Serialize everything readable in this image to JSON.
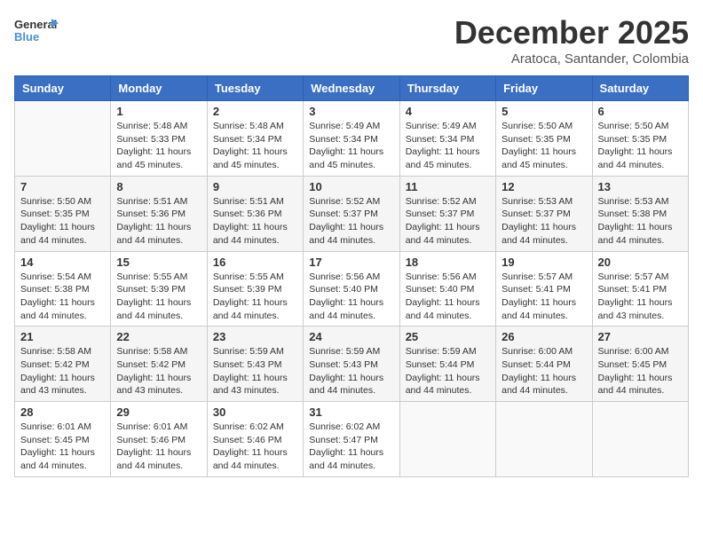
{
  "logo": {
    "text_general": "General",
    "text_blue": "Blue"
  },
  "title": "December 2025",
  "location": "Aratoca, Santander, Colombia",
  "weekdays": [
    "Sunday",
    "Monday",
    "Tuesday",
    "Wednesday",
    "Thursday",
    "Friday",
    "Saturday"
  ],
  "weeks": [
    [
      {
        "day": "",
        "info": ""
      },
      {
        "day": "1",
        "info": "Sunrise: 5:48 AM\nSunset: 5:33 PM\nDaylight: 11 hours\nand 45 minutes."
      },
      {
        "day": "2",
        "info": "Sunrise: 5:48 AM\nSunset: 5:34 PM\nDaylight: 11 hours\nand 45 minutes."
      },
      {
        "day": "3",
        "info": "Sunrise: 5:49 AM\nSunset: 5:34 PM\nDaylight: 11 hours\nand 45 minutes."
      },
      {
        "day": "4",
        "info": "Sunrise: 5:49 AM\nSunset: 5:34 PM\nDaylight: 11 hours\nand 45 minutes."
      },
      {
        "day": "5",
        "info": "Sunrise: 5:50 AM\nSunset: 5:35 PM\nDaylight: 11 hours\nand 45 minutes."
      },
      {
        "day": "6",
        "info": "Sunrise: 5:50 AM\nSunset: 5:35 PM\nDaylight: 11 hours\nand 44 minutes."
      }
    ],
    [
      {
        "day": "7",
        "info": "Sunrise: 5:50 AM\nSunset: 5:35 PM\nDaylight: 11 hours\nand 44 minutes."
      },
      {
        "day": "8",
        "info": "Sunrise: 5:51 AM\nSunset: 5:36 PM\nDaylight: 11 hours\nand 44 minutes."
      },
      {
        "day": "9",
        "info": "Sunrise: 5:51 AM\nSunset: 5:36 PM\nDaylight: 11 hours\nand 44 minutes."
      },
      {
        "day": "10",
        "info": "Sunrise: 5:52 AM\nSunset: 5:37 PM\nDaylight: 11 hours\nand 44 minutes."
      },
      {
        "day": "11",
        "info": "Sunrise: 5:52 AM\nSunset: 5:37 PM\nDaylight: 11 hours\nand 44 minutes."
      },
      {
        "day": "12",
        "info": "Sunrise: 5:53 AM\nSunset: 5:37 PM\nDaylight: 11 hours\nand 44 minutes."
      },
      {
        "day": "13",
        "info": "Sunrise: 5:53 AM\nSunset: 5:38 PM\nDaylight: 11 hours\nand 44 minutes."
      }
    ],
    [
      {
        "day": "14",
        "info": "Sunrise: 5:54 AM\nSunset: 5:38 PM\nDaylight: 11 hours\nand 44 minutes."
      },
      {
        "day": "15",
        "info": "Sunrise: 5:55 AM\nSunset: 5:39 PM\nDaylight: 11 hours\nand 44 minutes."
      },
      {
        "day": "16",
        "info": "Sunrise: 5:55 AM\nSunset: 5:39 PM\nDaylight: 11 hours\nand 44 minutes."
      },
      {
        "day": "17",
        "info": "Sunrise: 5:56 AM\nSunset: 5:40 PM\nDaylight: 11 hours\nand 44 minutes."
      },
      {
        "day": "18",
        "info": "Sunrise: 5:56 AM\nSunset: 5:40 PM\nDaylight: 11 hours\nand 44 minutes."
      },
      {
        "day": "19",
        "info": "Sunrise: 5:57 AM\nSunset: 5:41 PM\nDaylight: 11 hours\nand 44 minutes."
      },
      {
        "day": "20",
        "info": "Sunrise: 5:57 AM\nSunset: 5:41 PM\nDaylight: 11 hours\nand 43 minutes."
      }
    ],
    [
      {
        "day": "21",
        "info": "Sunrise: 5:58 AM\nSunset: 5:42 PM\nDaylight: 11 hours\nand 43 minutes."
      },
      {
        "day": "22",
        "info": "Sunrise: 5:58 AM\nSunset: 5:42 PM\nDaylight: 11 hours\nand 43 minutes."
      },
      {
        "day": "23",
        "info": "Sunrise: 5:59 AM\nSunset: 5:43 PM\nDaylight: 11 hours\nand 43 minutes."
      },
      {
        "day": "24",
        "info": "Sunrise: 5:59 AM\nSunset: 5:43 PM\nDaylight: 11 hours\nand 44 minutes."
      },
      {
        "day": "25",
        "info": "Sunrise: 5:59 AM\nSunset: 5:44 PM\nDaylight: 11 hours\nand 44 minutes."
      },
      {
        "day": "26",
        "info": "Sunrise: 6:00 AM\nSunset: 5:44 PM\nDaylight: 11 hours\nand 44 minutes."
      },
      {
        "day": "27",
        "info": "Sunrise: 6:00 AM\nSunset: 5:45 PM\nDaylight: 11 hours\nand 44 minutes."
      }
    ],
    [
      {
        "day": "28",
        "info": "Sunrise: 6:01 AM\nSunset: 5:45 PM\nDaylight: 11 hours\nand 44 minutes."
      },
      {
        "day": "29",
        "info": "Sunrise: 6:01 AM\nSunset: 5:46 PM\nDaylight: 11 hours\nand 44 minutes."
      },
      {
        "day": "30",
        "info": "Sunrise: 6:02 AM\nSunset: 5:46 PM\nDaylight: 11 hours\nand 44 minutes."
      },
      {
        "day": "31",
        "info": "Sunrise: 6:02 AM\nSunset: 5:47 PM\nDaylight: 11 hours\nand 44 minutes."
      },
      {
        "day": "",
        "info": ""
      },
      {
        "day": "",
        "info": ""
      },
      {
        "day": "",
        "info": ""
      }
    ]
  ]
}
